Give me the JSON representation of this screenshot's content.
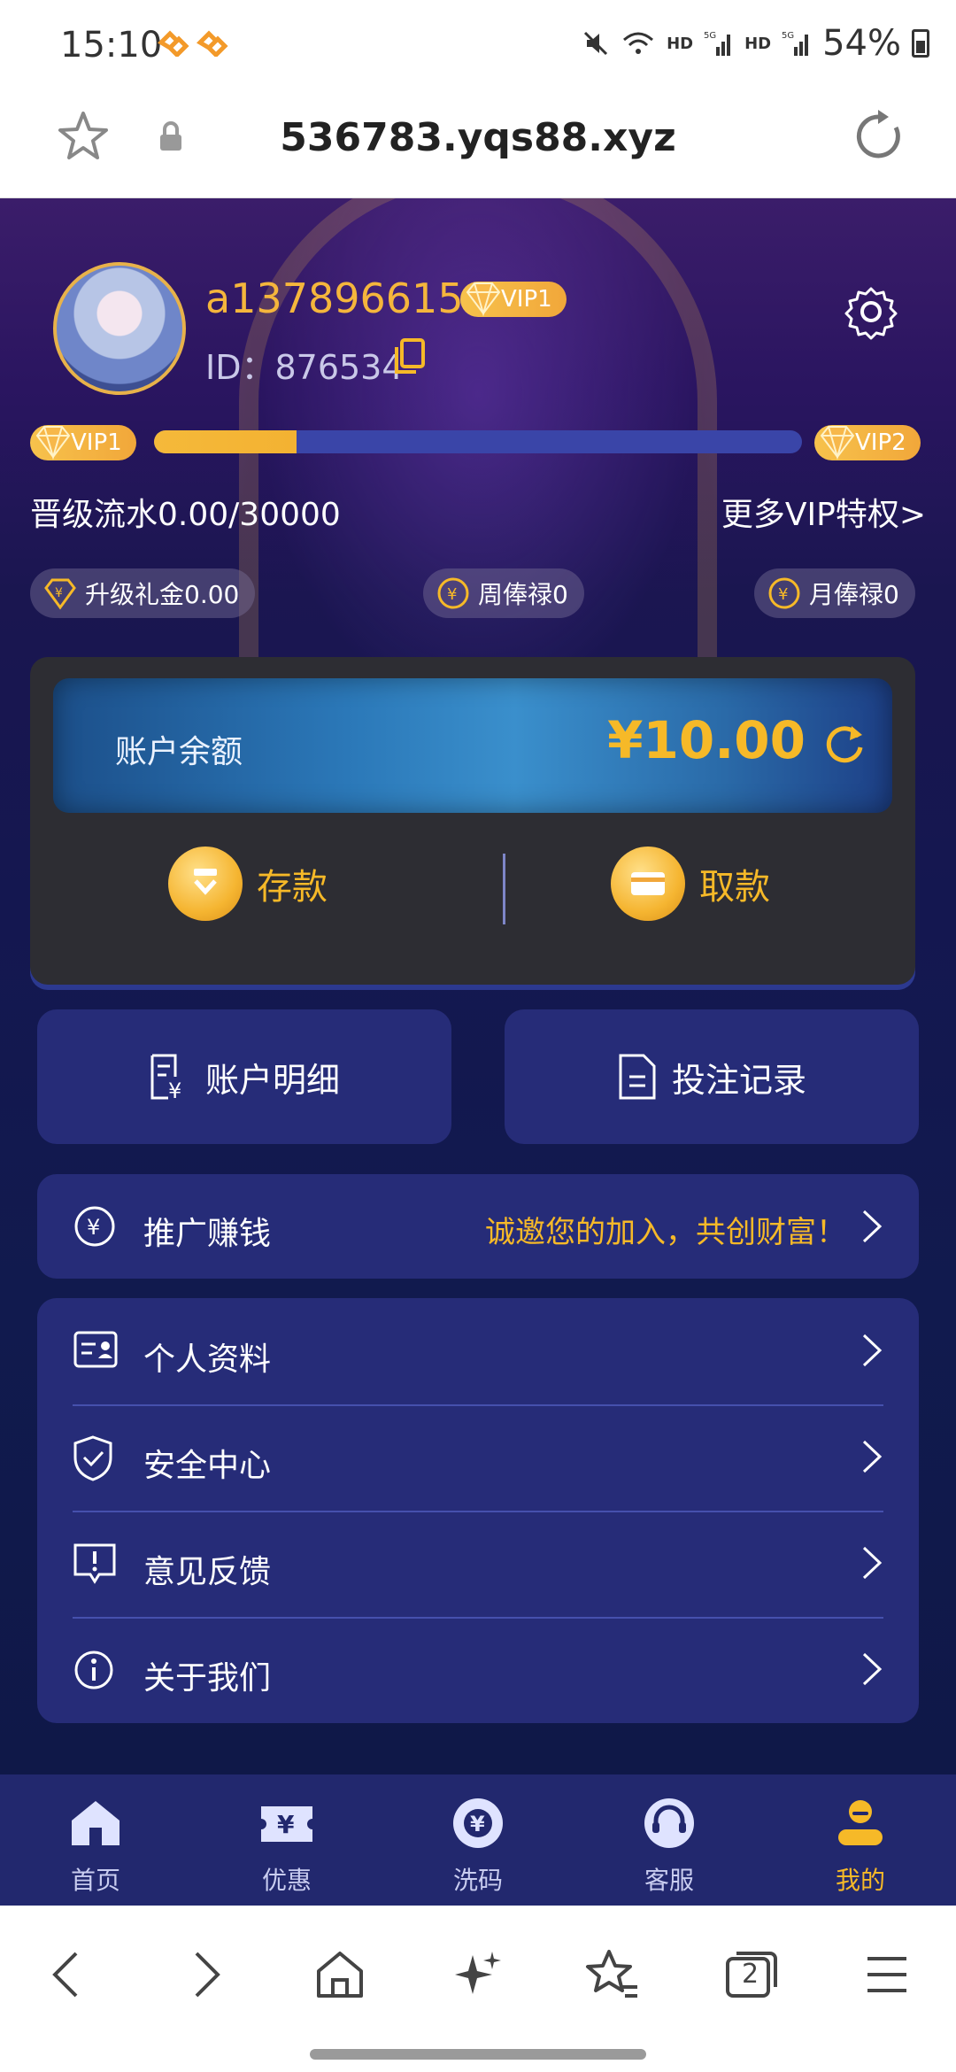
{
  "status_bar": {
    "time": "15:10",
    "network_1": "HD",
    "network_2": "HD",
    "signal_label": "5G",
    "battery": "54%"
  },
  "browser": {
    "url": "536783.yqs88.xyz"
  },
  "profile": {
    "username": "a1378966150",
    "vip_level": "VIP1",
    "id_text": "ID：876534",
    "vip_current": "VIP1",
    "vip_next": "VIP2",
    "progress_fraction": 0.22,
    "upgrade_text": "晋级流水0.00/30000",
    "more_vip": "更多VIP特权>",
    "rewards": [
      {
        "label": "升级礼金0.00"
      },
      {
        "label": "周俸禄0"
      },
      {
        "label": "月俸禄0"
      }
    ]
  },
  "balance": {
    "label": "账户余额",
    "value": "¥10.00",
    "deposit": "存款",
    "withdraw": "取款"
  },
  "quick_buttons": {
    "account_details": "账户明细",
    "bet_records": "投注记录"
  },
  "promo": {
    "title": "推广赚钱",
    "tagline": "诚邀您的加入，共创财富！"
  },
  "menu": {
    "items": [
      {
        "label": "个人资料"
      },
      {
        "label": "安全中心"
      },
      {
        "label": "意见反馈"
      },
      {
        "label": "关于我们"
      }
    ]
  },
  "tabs": [
    {
      "label": "首页"
    },
    {
      "label": "优惠"
    },
    {
      "label": "洗码"
    },
    {
      "label": "客服"
    },
    {
      "label": "我的"
    }
  ],
  "browser_nav": {
    "tab_count": "2"
  },
  "colors": {
    "accent_gold": "#f6b928",
    "panel_blue": "#262c78",
    "tabbar_bg": "#22286e"
  }
}
